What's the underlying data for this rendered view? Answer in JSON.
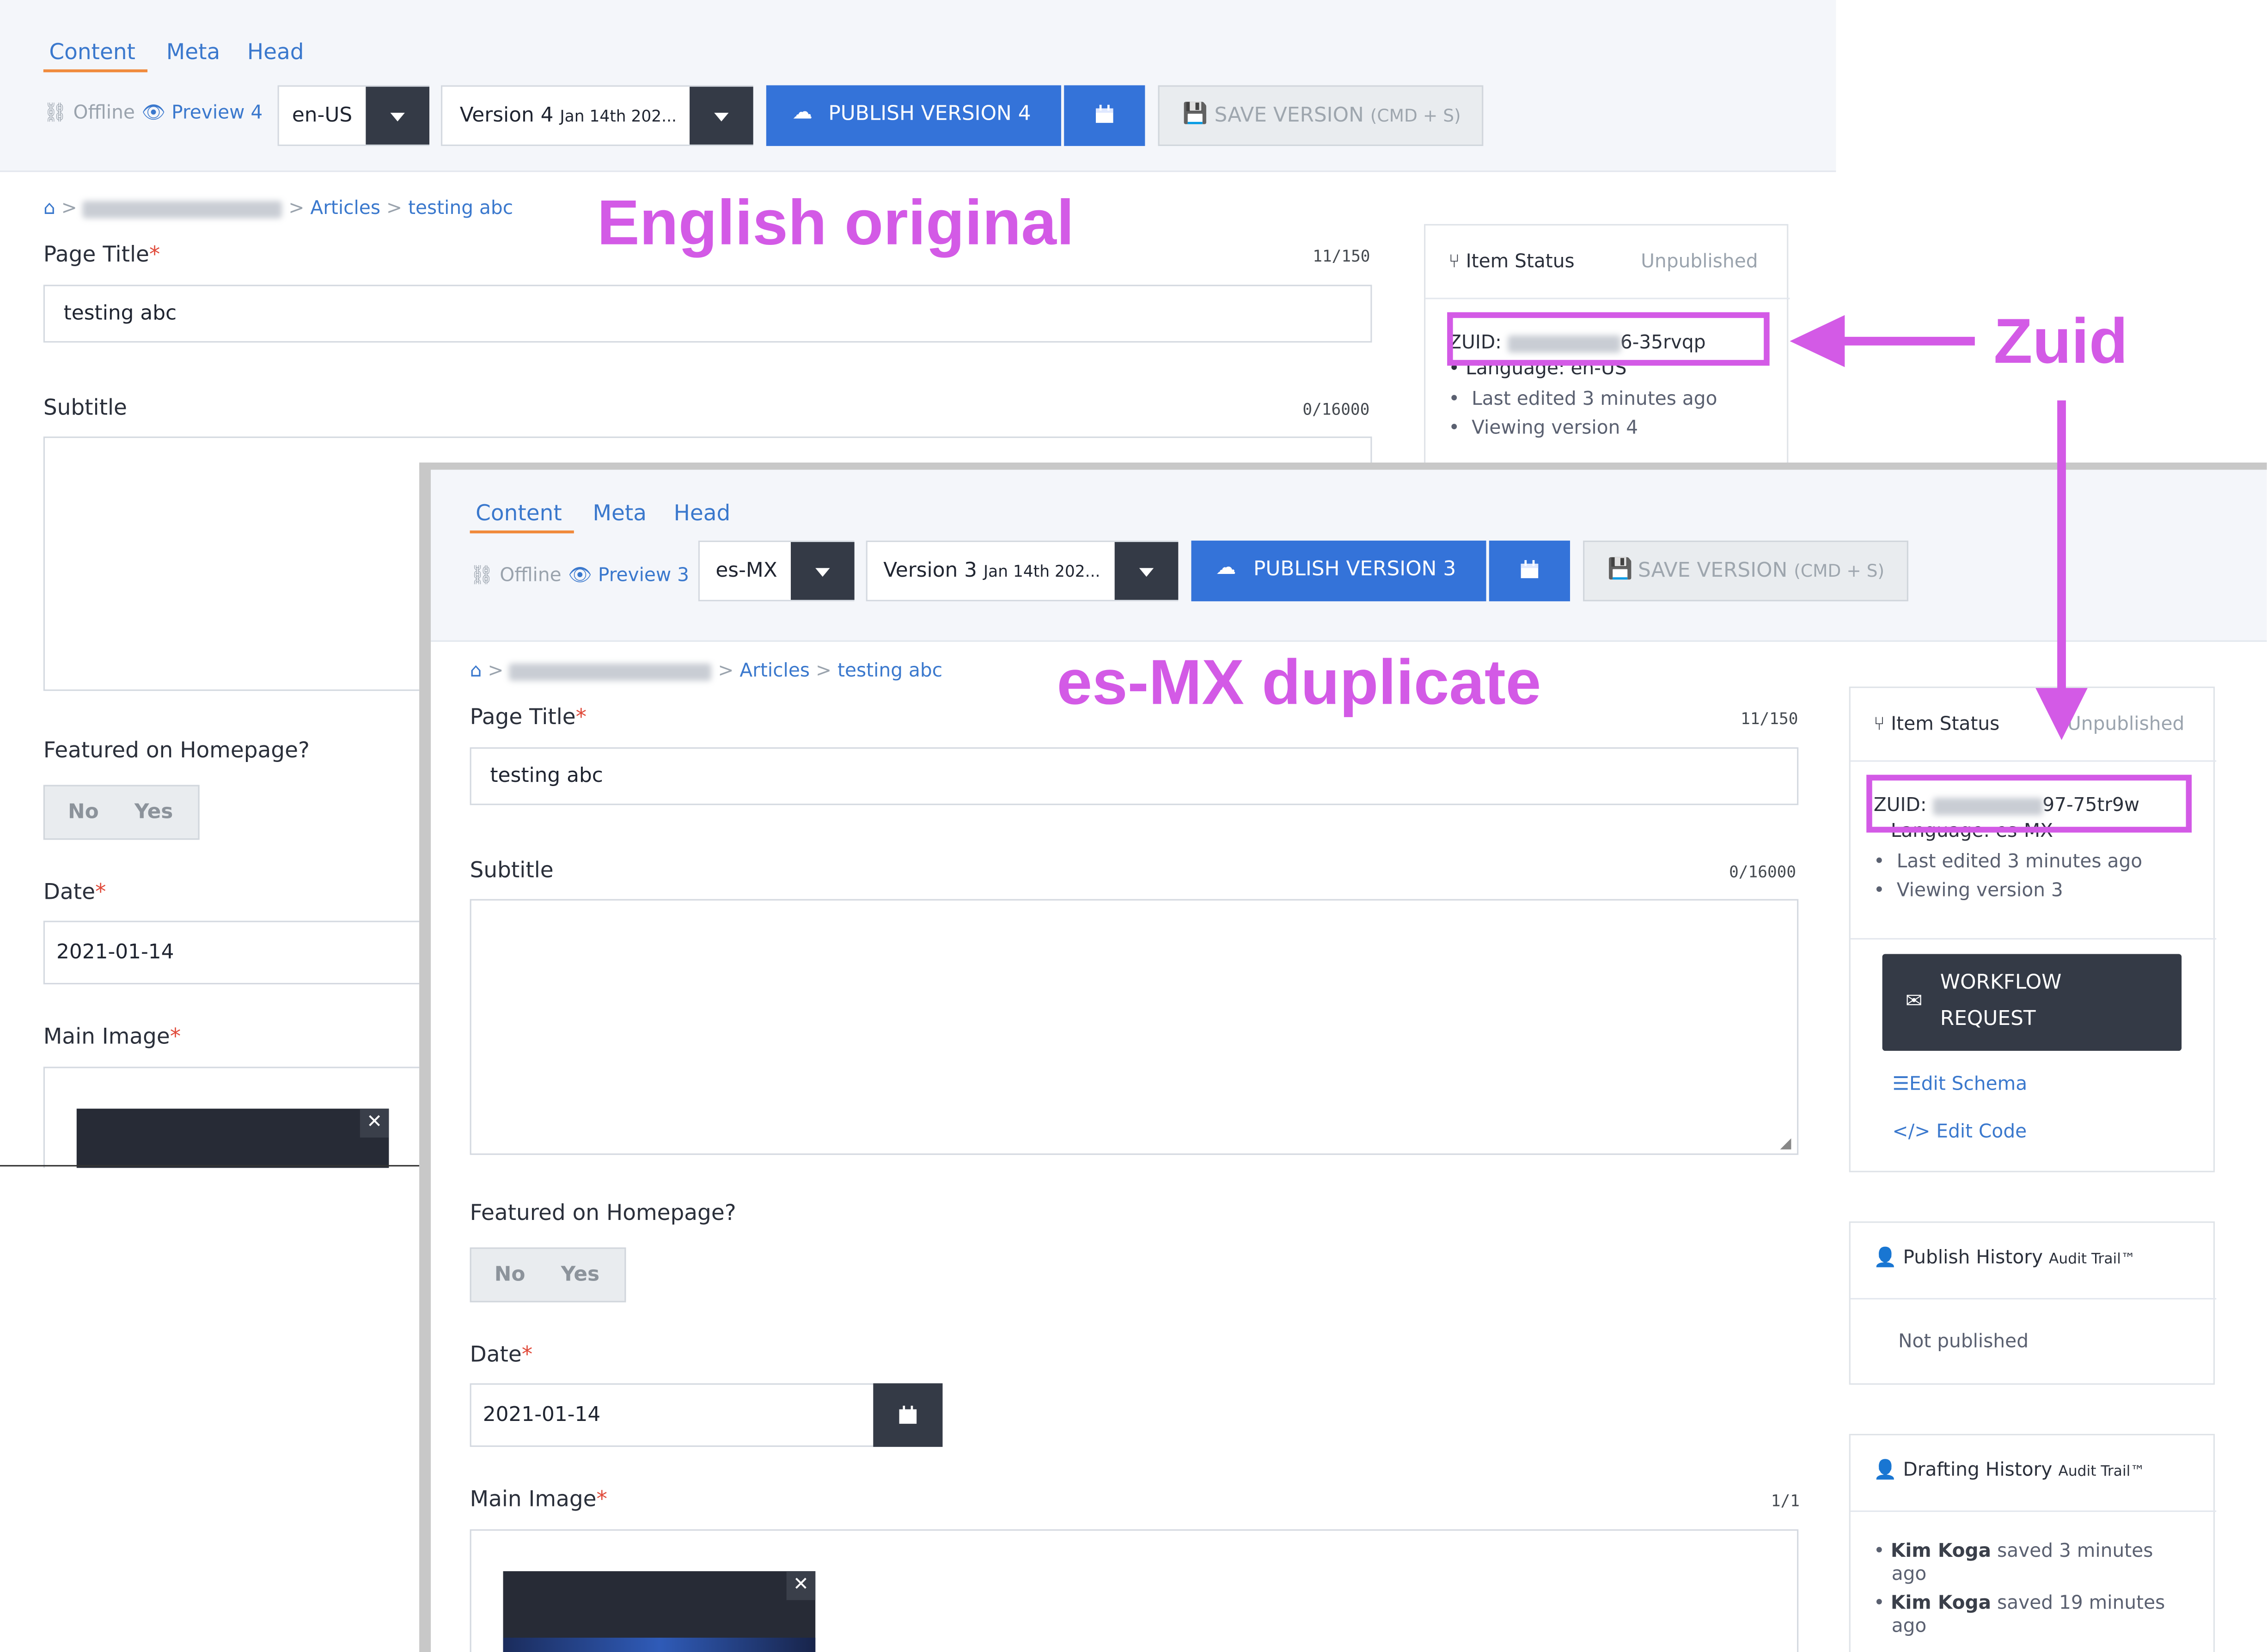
{
  "annotations": {
    "english_original": "English original",
    "es_mx_duplicate": "es-MX duplicate",
    "zuid": "Zuid",
    "accent_color": "#d35ae6"
  },
  "common": {
    "tabs": [
      "Content",
      "Meta",
      "Head"
    ],
    "offline": "Offline",
    "save_label": "SAVE VERSION",
    "save_shortcut": "(CMD + S)",
    "breadcrumb_articles": "Articles",
    "breadcrumb_sep": ">",
    "page_title_label": "Page Title",
    "required_mark": "*",
    "page_title_value": "testing abc",
    "page_title_counter": "11/150",
    "subtitle_label": "Subtitle",
    "subtitle_counter": "0/16000",
    "featured_label": "Featured on Homepage?",
    "no": "No",
    "yes": "Yes",
    "date_label": "Date",
    "date_value": "2021-01-14",
    "main_image_label": "Main Image",
    "main_image_counter": "1/1",
    "item_status": "Item Status",
    "unpublished": "Unpublished",
    "zuid_label": "ZUID:",
    "last_edited": "Last edited 3 minutes ago",
    "workflow_request_line1": "WORKFLOW",
    "workflow_request_line2": "REQUEST",
    "edit_schema": "Edit Schema",
    "edit_code": "Edit Code",
    "publish_history": "Publish History",
    "audit_trail": "Audit Trail™",
    "not_published": "Not published",
    "drafting_history": "Drafting History"
  },
  "original": {
    "preview": "Preview 4",
    "language": "en-US",
    "version_label": "Version 4",
    "version_date": "Jan 14th 202...",
    "publish_label": "PUBLISH VERSION 4",
    "zuid_suffix": "6-35rvqp",
    "language_line": "Language: en-US",
    "viewing_version": "Viewing version 4"
  },
  "duplicate": {
    "preview": "Preview 3",
    "language": "es-MX",
    "version_label": "Version 3",
    "version_date": "Jan 14th 202...",
    "publish_label": "PUBLISH VERSION 3",
    "zuid_suffix": "97-75tr9w",
    "language_line": "Language: es-MX",
    "viewing_version": "Viewing version 3",
    "drafting_entries": [
      {
        "user": "Kim Koga",
        "action": "saved 3 minutes",
        "tail": "ago"
      },
      {
        "user": "Kim Koga",
        "action": "saved 19 minutes",
        "tail": "ago"
      }
    ]
  }
}
